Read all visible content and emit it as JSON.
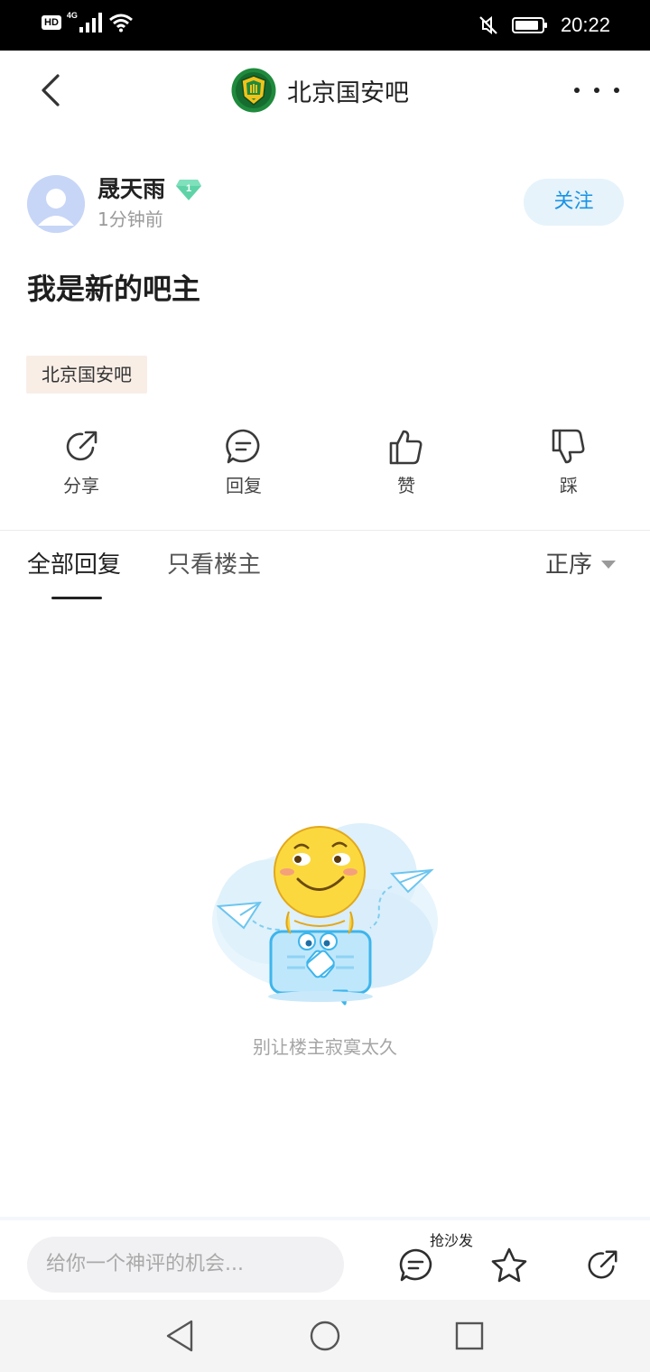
{
  "status_bar": {
    "network_badge": "HD",
    "network_type": "4G",
    "time": "20:22",
    "icons": [
      "signal-icon",
      "wifi-icon",
      "mute-icon",
      "battery-icon"
    ]
  },
  "header": {
    "forum_title": "北京国安吧",
    "icons": [
      "back-arrow-icon",
      "forum-logo-icon",
      "more-icon"
    ]
  },
  "post": {
    "author": "晟天雨",
    "level": "1",
    "time_ago": "1分钟前",
    "follow_label": "关注",
    "title": "我是新的吧主",
    "forum_tag": "北京国安吧"
  },
  "actions": [
    {
      "label": "分享",
      "icon": "share-icon"
    },
    {
      "label": "回复",
      "icon": "comment-icon"
    },
    {
      "label": "赞",
      "icon": "thumbs-up-icon"
    },
    {
      "label": "踩",
      "icon": "thumbs-down-icon"
    }
  ],
  "tabs": {
    "all_replies": "全部回复",
    "owner_only": "只看楼主",
    "sort_label": "正序"
  },
  "empty_state": {
    "message": "别让楼主寂寞太久"
  },
  "bottom_bar": {
    "input_placeholder": "给你一个神评的机会...",
    "sofa_label": "抢沙发",
    "icons": [
      "comment-icon",
      "star-icon",
      "share-icon"
    ]
  },
  "nav_bar": {
    "icons": [
      "nav-back-icon",
      "nav-home-icon",
      "nav-recents-icon"
    ]
  },
  "colors": {
    "accent_blue": "#1a93e4",
    "follow_bg": "#e6f3fb",
    "tag_bg": "#f8eee6",
    "level_badge": "#5fd3a8",
    "logo_green": "#1f8a3c"
  }
}
